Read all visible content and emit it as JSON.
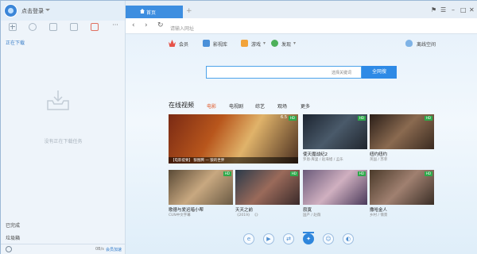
{
  "left": {
    "login": "点击登录",
    "section": "正在下载",
    "empty": "没有正在下载任务",
    "done": "已完成",
    "trash": "垃圾箱",
    "speed": "0B/s",
    "vip": "会员加速"
  },
  "browser": {
    "tab_label": "首页",
    "url_placeholder": "请输入网址"
  },
  "quick": {
    "vip": "会员",
    "movie": "影视库",
    "game": "游戏",
    "discover": "发现",
    "space": "离线空间"
  },
  "search": {
    "select": "选择关键词",
    "button": "全网搜"
  },
  "video": {
    "title": "在线视频",
    "tabs": [
      "电影",
      "电视剧",
      "综艺",
      "观场",
      "更多"
    ]
  },
  "cards": [
    {
      "caption": "【电影提要】 狼图腾 — 狼的世界",
      "score": "6.5"
    },
    {
      "caption": "使天魔战纪2",
      "sub": "罗恩·库里 / 赵海旭 / 孟乐",
      "score": "6.2"
    },
    {
      "caption": "纽约纽约",
      "sub": "英国 / 苏菲",
      "score": "5.3"
    },
    {
      "caption": "歌德与爱迟暗小帮",
      "sub": "CUN中文字幕",
      "score": "8.0"
    },
    {
      "caption": "天天之前",
      "sub": "《2019》 《》",
      "score": "7.3"
    },
    {
      "caption": "寂寞",
      "sub": "国产 / 赵薇",
      "score": "6.5"
    },
    {
      "caption": "撒哈金人",
      "sub": "乡村 / 情景",
      "score": "4.4"
    }
  ],
  "colors": {
    "accent": "#2e8ae6",
    "tab": "#3d8ee0",
    "active_tab_text": "#e05a2a",
    "badge": "#2ea94a"
  }
}
